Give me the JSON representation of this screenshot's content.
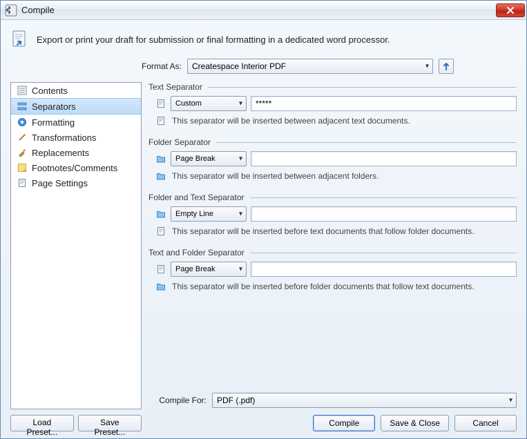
{
  "window": {
    "title": "Compile"
  },
  "intro": "Export or print your draft for submission or final formatting in a dedicated word processor.",
  "formatAs": {
    "label": "Format As:",
    "value": "Createspace Interior PDF"
  },
  "sidebar": {
    "items": [
      {
        "label": "Contents"
      },
      {
        "label": "Separators"
      },
      {
        "label": "Formatting"
      },
      {
        "label": "Transformations"
      },
      {
        "label": "Replacements"
      },
      {
        "label": "Footnotes/Comments"
      },
      {
        "label": "Page Settings"
      }
    ],
    "selectedIndex": 1,
    "loadPreset": "Load Preset...",
    "savePreset": "Save Preset..."
  },
  "sections": {
    "text": {
      "title": "Text Separator",
      "mode": "Custom",
      "value": "*****",
      "help": "This separator will be inserted between adjacent text documents."
    },
    "folder": {
      "title": "Folder Separator",
      "mode": "Page Break",
      "value": "",
      "help": "This separator will be inserted between adjacent folders."
    },
    "folderText": {
      "title": "Folder and Text Separator",
      "mode": "Empty Line",
      "value": "",
      "help": "This separator will be inserted before text documents that follow folder documents."
    },
    "textFolder": {
      "title": "Text and Folder Separator",
      "mode": "Page Break",
      "value": "",
      "help": "This separator will be inserted before folder documents that follow text documents."
    }
  },
  "compileFor": {
    "label": "Compile For:",
    "value": "PDF (.pdf)"
  },
  "buttons": {
    "compile": "Compile",
    "saveClose": "Save & Close",
    "cancel": "Cancel"
  }
}
